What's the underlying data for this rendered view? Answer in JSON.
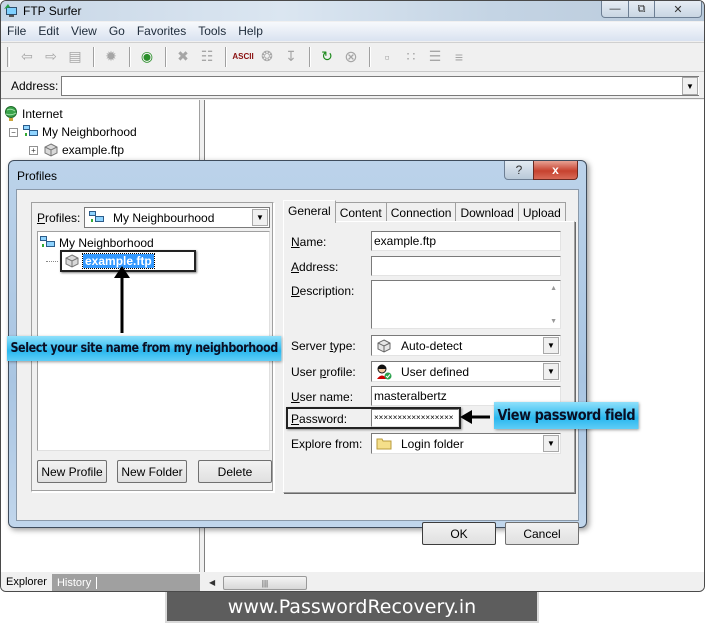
{
  "window": {
    "title": "FTP Surfer",
    "controls": {
      "minimize": "—",
      "maximize": "⧉",
      "close": "✕"
    }
  },
  "menu": [
    "File",
    "Edit",
    "View",
    "Go",
    "Favorites",
    "Tools",
    "Help"
  ],
  "toolbar": {
    "icons": [
      {
        "name": "back-icon",
        "glyph": "⇦"
      },
      {
        "name": "forward-icon",
        "glyph": "⇨"
      },
      {
        "name": "up-folder-icon",
        "glyph": "▤"
      },
      {
        "sep": true
      },
      {
        "name": "connect-icon",
        "glyph": "✹"
      },
      {
        "sep": true
      },
      {
        "name": "profiles-icon",
        "glyph": "◉"
      },
      {
        "sep": true
      },
      {
        "name": "delete-icon",
        "glyph": "✖"
      },
      {
        "name": "properties-icon",
        "glyph": "☷"
      },
      {
        "sep": true
      },
      {
        "name": "ascii-mode-icon",
        "glyph": "ASCII"
      },
      {
        "name": "chat-icon",
        "glyph": "❂"
      },
      {
        "name": "download-icon",
        "glyph": "↧"
      },
      {
        "sep": true
      },
      {
        "name": "refresh-icon",
        "glyph": "↻"
      },
      {
        "name": "stop-icon",
        "glyph": "⊗"
      },
      {
        "sep": true
      },
      {
        "name": "large-icons-view-icon",
        "glyph": "▫"
      },
      {
        "name": "small-icons-view-icon",
        "glyph": "∷"
      },
      {
        "name": "list-view-icon",
        "glyph": "☰"
      },
      {
        "name": "details-view-icon",
        "glyph": "≡"
      }
    ]
  },
  "address": {
    "label": "Address:",
    "value": ""
  },
  "explorer_tree": [
    {
      "label": "Internet",
      "icon": "globe-icon",
      "level": 0
    },
    {
      "label": "My Neighborhood",
      "icon": "network-icon",
      "level": 1,
      "expander": "−"
    },
    {
      "label": "example.ftp",
      "icon": "server-icon",
      "level": 2,
      "expander": "+"
    }
  ],
  "left_tabs": [
    "Explorer",
    "History"
  ],
  "dialog": {
    "title": "Profiles",
    "help": "?",
    "close": "x",
    "profiles_label": "Profiles:",
    "profiles_selected": "My Neighbourhood",
    "tree": [
      {
        "label": "My Neighborhood",
        "icon": "network-icon"
      },
      {
        "label": "example.ftp",
        "icon": "server-icon",
        "selected": true
      }
    ],
    "buttons": {
      "new_profile": "New Profile",
      "new_folder": "New Folder",
      "delete": "Delete",
      "ok": "OK",
      "cancel": "Cancel"
    },
    "tabs": [
      {
        "label": "General",
        "active": true
      },
      {
        "label": "Content"
      },
      {
        "label": "Connection"
      },
      {
        "label": "Download"
      },
      {
        "label": "Upload"
      }
    ],
    "general": {
      "name_label": "Name:",
      "name_value": "example.ftp",
      "address_label": "Address:",
      "address_value": "",
      "description_label": "Description:",
      "description_value": "",
      "server_type_label": "Server type:",
      "server_type_value": "Auto-detect",
      "user_profile_label": "User profile:",
      "user_profile_value": "User defined",
      "user_name_label": "User name:",
      "user_name_value": "masteralbertz",
      "password_label": "Password:",
      "password_value": "×××××××××××××××××",
      "explore_from_label": "Explore from:",
      "explore_from_value": "Login folder"
    }
  },
  "callouts": {
    "left": "Select your site name from my neighborhood",
    "right": "View password field"
  },
  "watermark": "www.PasswordRecovery.in",
  "colors": {
    "selection": "#3399ff",
    "callout": "#2ab8ef",
    "close_red": "#c7422f"
  }
}
